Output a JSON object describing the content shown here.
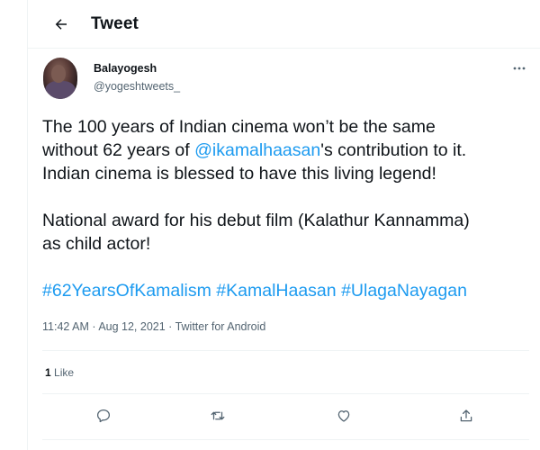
{
  "header": {
    "title": "Tweet",
    "back_icon": "arrow-left-icon"
  },
  "author": {
    "name": "Balayogesh",
    "handle": "@yogeshtweets_",
    "more_icon": "more-horizontal-icon"
  },
  "tweet": {
    "line1": "The 100 years of Indian cinema won’t be the same",
    "line2_prefix": "without 62 years of ",
    "mention": "@ikamalhaasan",
    "line2_suffix": "'s contribution to it.",
    "line3": "Indian cinema is blessed to have this living legend!",
    "line4": "National award for his debut film (Kalathur Kannamma)",
    "line5": "as child actor!",
    "hashtags": [
      "#62YearsOfKamalism",
      "#KamalHaasan",
      "#UlagaNayagan"
    ]
  },
  "meta": {
    "time": "11:42 AM",
    "separator": " · ",
    "date": "Aug 12, 2021",
    "source": "Twitter for Android"
  },
  "stats": {
    "like_count": "1",
    "like_label": " Like"
  },
  "actions": {
    "reply_icon": "reply-icon",
    "retweet_icon": "retweet-icon",
    "like_icon": "heart-icon",
    "share_icon": "share-icon"
  },
  "colors": {
    "link": "#1d9bf0",
    "text": "#0f1419",
    "muted": "#536471",
    "border": "#eff3f4"
  }
}
